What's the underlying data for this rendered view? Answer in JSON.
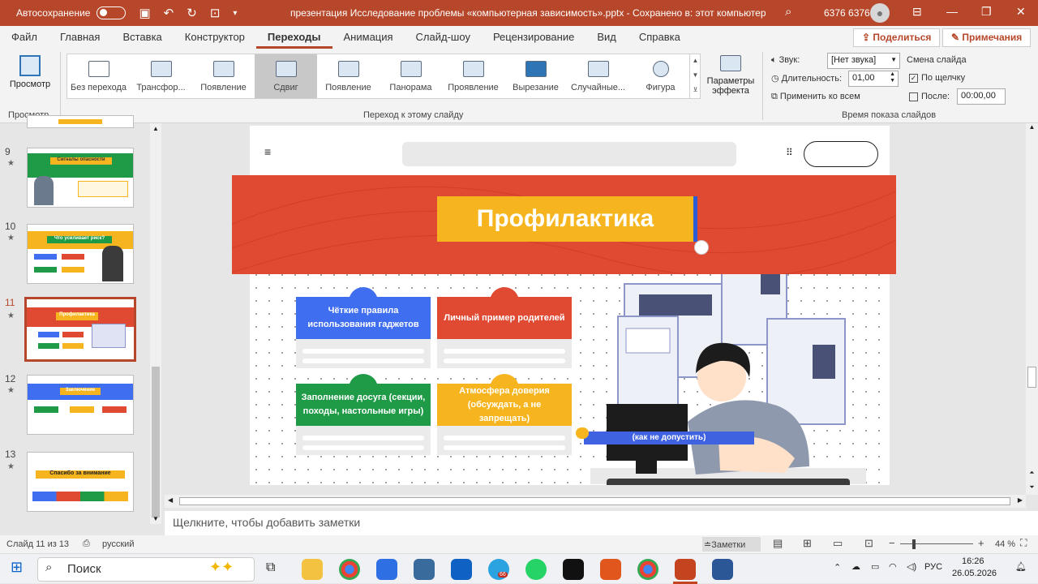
{
  "titlebar": {
    "autosave_label": "Автосохранение",
    "document_title": "презентация Исследование проблемы «компьютерная зависимость».pptx  -  Сохранено в: этот компьютер",
    "user_name": "6376 6376"
  },
  "menu": {
    "items": [
      "Файл",
      "Главная",
      "Вставка",
      "Конструктор",
      "Переходы",
      "Анимация",
      "Слайд-шоу",
      "Рецензирование",
      "Вид",
      "Справка"
    ],
    "active": "Переходы",
    "share_label": "Поделиться",
    "comments_label": "Примечания"
  },
  "ribbon": {
    "preview_label": "Просмотр",
    "preview_group": "Просмотр",
    "transitions": [
      "Без перехода",
      "Трансфор...",
      "Появление",
      "Сдвиг",
      "Появление",
      "Панорама",
      "Проявление",
      "Вырезание",
      "Случайные...",
      "Фигура"
    ],
    "selected_transition": "Сдвиг",
    "transitions_group": "Переход к этому слайду",
    "effect_params_line1": "Параметры",
    "effect_params_line2": "эффекта",
    "sound_label": "Звук:",
    "sound_value": "[Нет звука]",
    "duration_label": "Длительность:",
    "duration_value": "01,00",
    "apply_all_label": "Применить ко всем",
    "advance_label": "Смена слайда",
    "on_click_label": "По щелчку",
    "on_click_checked": true,
    "after_label": "После:",
    "after_value": "00:00,00",
    "timing_group": "Время показа слайдов"
  },
  "thumbnails": [
    {
      "number": "9",
      "title": "Сигналы опасности"
    },
    {
      "number": "10",
      "title": "Что усиливает риск?"
    },
    {
      "number": "11",
      "title": "Профилактика"
    },
    {
      "number": "12",
      "title": "Заключение"
    },
    {
      "number": "13",
      "title": "Спасибо за внимание"
    }
  ],
  "selected_slide": "11",
  "slide": {
    "title": "Профилактика",
    "cards": [
      {
        "text": "Чёткие правила использования гаджетов",
        "color": "#3f6ef0"
      },
      {
        "text": "Личный пример родителей",
        "color": "#e04a32"
      },
      {
        "text": "Заполнение досуга (секции, походы, настольные игры)",
        "color": "#1f9a47"
      },
      {
        "text": "Атмосфера доверия (обсуждать, а не запрещать)",
        "color": "#f6b51f"
      }
    ],
    "label": "(как не допустить)"
  },
  "notes_placeholder": "Щелкните, чтобы добавить заметки",
  "status": {
    "slide_info": "Слайд 11 из 13",
    "language": "русский",
    "notes_label": "Заметки",
    "zoom": "44 %"
  },
  "taskbar": {
    "search_label": "Поиск",
    "input_lang": "РУС",
    "time": "16:26",
    "date": "26.05.2026",
    "telegram_badge": "66"
  },
  "colors": {
    "accent": "#b7472a",
    "banner_red": "#e04a32",
    "title_yellow": "#f6b51f",
    "blue": "#3f6ef0",
    "green": "#1f9a47"
  }
}
